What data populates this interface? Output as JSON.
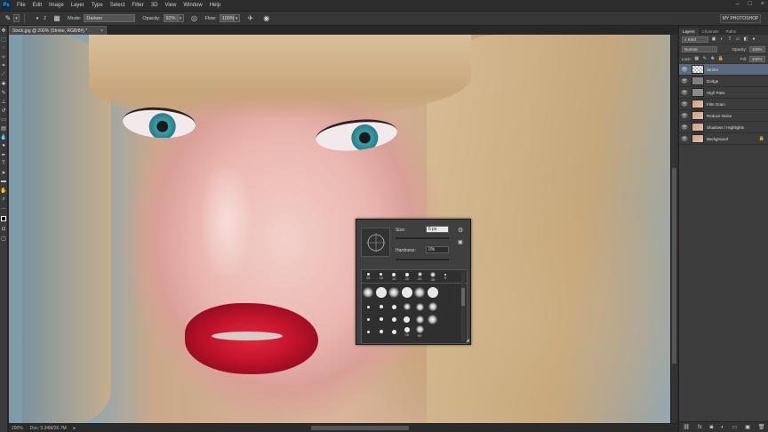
{
  "menu": {
    "logo": "Ps",
    "items": [
      "File",
      "Edit",
      "Image",
      "Layer",
      "Type",
      "Select",
      "Filter",
      "3D",
      "View",
      "Window",
      "Help"
    ]
  },
  "options_bar": {
    "brush_size": "2",
    "mode_label": "Mode:",
    "mode_value": "Darken",
    "opacity_label": "Opacity:",
    "opacity_value": "92%",
    "flow_label": "Flow:",
    "flow_value": "100%",
    "workspace": "MY PHOTOSHOP"
  },
  "document": {
    "tab_title": "Stock.jpg @ 200% (Stroke, RGB/8#) *",
    "close": "×"
  },
  "status": {
    "zoom": "200%",
    "doc_size": "Doc: 5.34M/26.7M"
  },
  "brush_picker": {
    "size_label": "Size:",
    "size_value": "5 px",
    "hardness_label": "Hardness:",
    "hardness_value": "0%",
    "preset_labels": [
      "25",
      "15",
      "10",
      "20",
      "25",
      "35",
      "5"
    ],
    "row_bottom_labels": [
      "25",
      "50"
    ],
    "resize": "◢"
  },
  "layers_panel": {
    "tabs": [
      "Layers",
      "Channels",
      "Paths"
    ],
    "filter_label": "Kind",
    "blend_mode": "Normal",
    "opacity_label": "Opacity:",
    "opacity_value": "100%",
    "lock_label": "Lock:",
    "fill_label": "Fill:",
    "fill_value": "100%",
    "layers": [
      {
        "name": "Stroke",
        "active": true
      },
      {
        "name": "Dodge",
        "active": false
      },
      {
        "name": "High Pass",
        "active": false
      },
      {
        "name": "Film Grain",
        "active": false
      },
      {
        "name": "Reduce Noise",
        "active": false
      },
      {
        "name": "Shadows / Highlights",
        "active": false
      },
      {
        "name": "Background",
        "active": false
      }
    ]
  },
  "colors": {
    "accent_selected_layer": "#5a6a7e",
    "lip_red": "#c4142c",
    "iris_teal": "#2a7b86"
  }
}
